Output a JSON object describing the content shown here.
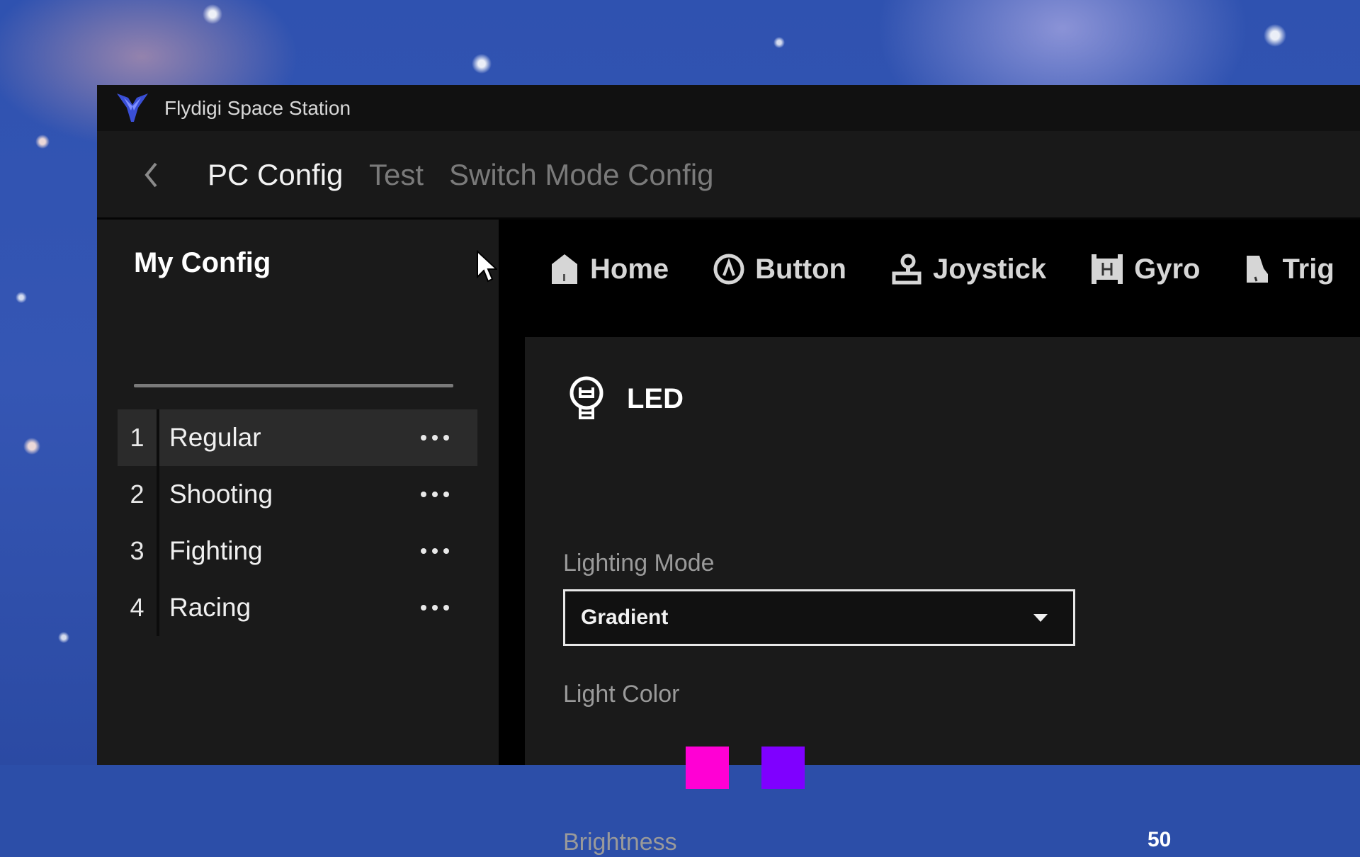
{
  "window": {
    "title": "Flydigi Space Station",
    "logo_icon": "flydigi-logo-icon",
    "logo_color": "#3a4fd6"
  },
  "nav": {
    "back_icon": "chevron-left-icon",
    "links": [
      {
        "label": "PC Config",
        "active": true
      },
      {
        "label": "Test",
        "active": false
      },
      {
        "label": "Switch Mode Config",
        "active": false
      }
    ]
  },
  "sidebar": {
    "title": "My Config",
    "configs": [
      {
        "index": "1",
        "name": "Regular",
        "selected": true
      },
      {
        "index": "2",
        "name": "Shooting",
        "selected": false
      },
      {
        "index": "3",
        "name": "Fighting",
        "selected": false
      },
      {
        "index": "4",
        "name": "Racing",
        "selected": false
      }
    ],
    "more_icon": "more-horizontal-icon"
  },
  "tabs": [
    {
      "label": "Home",
      "icon": "home-icon"
    },
    {
      "label": "Button",
      "icon": "button-a-icon"
    },
    {
      "label": "Joystick",
      "icon": "joystick-icon"
    },
    {
      "label": "Gyro",
      "icon": "gyro-icon"
    },
    {
      "label": "Trig",
      "icon": "trigger-icon"
    }
  ],
  "led": {
    "title": "LED",
    "icon": "lightbulb-icon",
    "lighting_mode_label": "Lighting Mode",
    "lighting_mode_value": "Gradient",
    "light_color_label": "Light Color",
    "colors": [
      "#ff00d4",
      "#7f00ff"
    ],
    "brightness_label": "Brightness",
    "brightness_value": "50"
  }
}
